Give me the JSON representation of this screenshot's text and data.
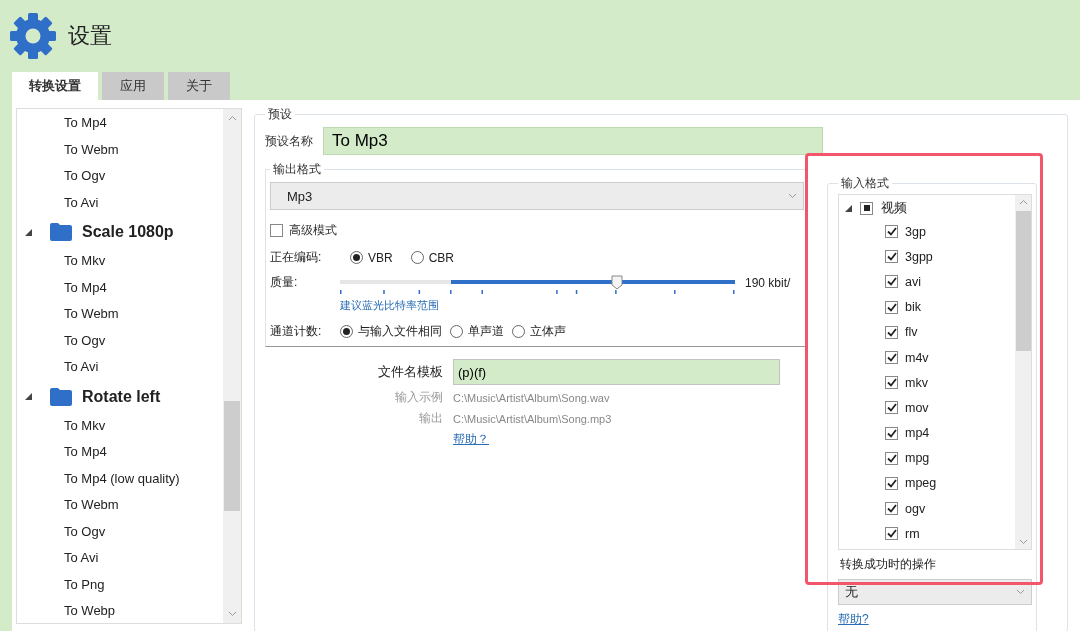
{
  "window": {
    "title": "设置"
  },
  "tabs": [
    {
      "label": "转换设置",
      "selected": true
    },
    {
      "label": "应用",
      "selected": false
    },
    {
      "label": "关于",
      "selected": false
    }
  ],
  "preset_tree": [
    {
      "label": "To Mp4"
    },
    {
      "label": "To Webm"
    },
    {
      "label": "To Ogv"
    },
    {
      "label": "To Avi"
    },
    {
      "label": "Scale 1080p",
      "expanded": true,
      "children": [
        {
          "label": "To Mkv"
        },
        {
          "label": "To Mp4"
        },
        {
          "label": "To Webm"
        },
        {
          "label": "To Ogv"
        },
        {
          "label": "To Avi"
        }
      ]
    },
    {
      "label": "Rotate left",
      "expanded": true,
      "children": [
        {
          "label": "To Mkv"
        },
        {
          "label": "To Mp4"
        },
        {
          "label": "To Mp4 (low quality)"
        },
        {
          "label": "To Webm"
        },
        {
          "label": "To Ogv"
        },
        {
          "label": "To Avi"
        },
        {
          "label": "To Png"
        },
        {
          "label": "To Webp"
        }
      ]
    }
  ],
  "preset": {
    "legend": "预设",
    "name_label": "预设名称",
    "name_value": "To Mp3"
  },
  "output_format": {
    "legend": "输出格式",
    "dropdown": "Mp3",
    "advanced": {
      "label": "高级模式",
      "checked": false
    },
    "encoding": {
      "label": "正在编码:",
      "options": [
        {
          "label": "VBR",
          "selected": true
        },
        {
          "label": "CBR",
          "selected": false
        }
      ]
    },
    "quality": {
      "label": "质量:",
      "level": 0.7,
      "reading": "190 kbit/"
    },
    "bitrate_link": "建议蓝光比特率范围",
    "channels": {
      "label": "通道计数:",
      "options": [
        {
          "label": "与输入文件相同",
          "selected": true
        },
        {
          "label": "单声道",
          "selected": false
        },
        {
          "label": "立体声",
          "selected": false
        }
      ]
    }
  },
  "filename": {
    "template_label": "文件名模板",
    "template_value": "(p)(f)",
    "example_label": "输入示例",
    "example_value": "C:\\Music\\Artist\\Album\\Song.wav",
    "output_label": "输出",
    "output_value": "C:\\Music\\Artist\\Album\\Song.mp3",
    "help": "帮助？"
  },
  "input_formats": {
    "legend": "输入格式",
    "root": {
      "label": "视频",
      "expanded": true,
      "indeterminate": true,
      "children": [
        {
          "label": "3gp",
          "checked": true
        },
        {
          "label": "3gpp",
          "checked": true
        },
        {
          "label": "avi",
          "checked": true
        },
        {
          "label": "bik",
          "checked": true
        },
        {
          "label": "flv",
          "checked": true
        },
        {
          "label": "m4v",
          "checked": true
        },
        {
          "label": "mkv",
          "checked": true
        },
        {
          "label": "mov",
          "checked": true
        },
        {
          "label": "mp4",
          "checked": true
        },
        {
          "label": "mpg",
          "checked": true
        },
        {
          "label": "mpeg",
          "checked": true
        },
        {
          "label": "ogv",
          "checked": true
        },
        {
          "label": "rm",
          "checked": true
        }
      ]
    },
    "on_success_label": "转换成功时的操作",
    "on_success_value": "无",
    "help": "帮助?"
  },
  "highlight": {
    "shown": true
  }
}
